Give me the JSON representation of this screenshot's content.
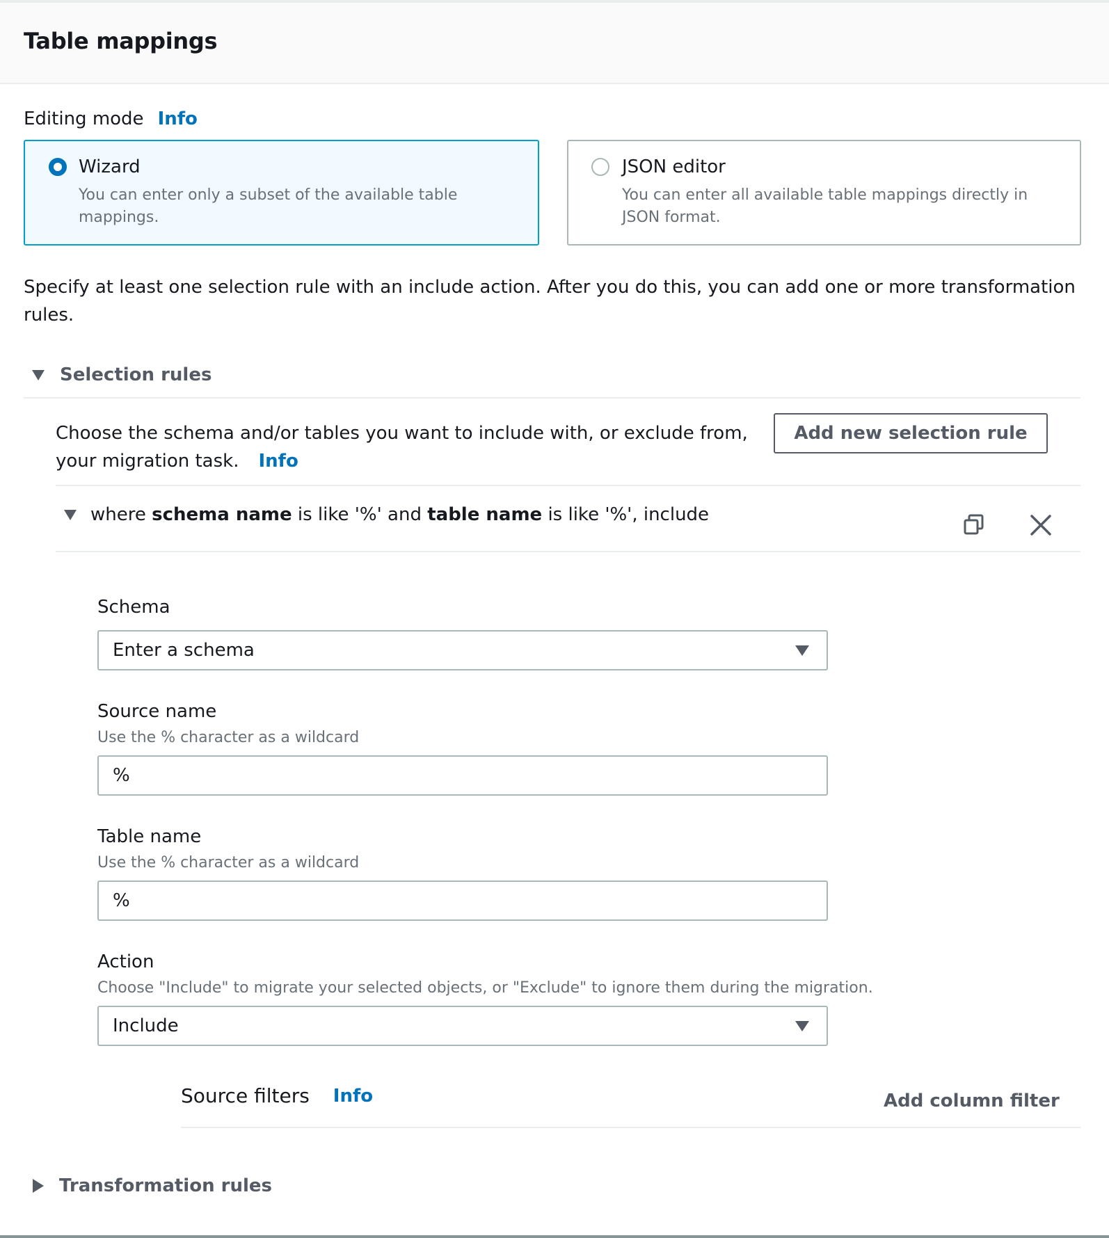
{
  "header": {
    "title": "Table mappings"
  },
  "editing_mode": {
    "label": "Editing mode",
    "info_label": "Info",
    "options": [
      {
        "id": "wizard",
        "title": "Wizard",
        "description": "You can enter only a subset of the available table mappings.",
        "selected": true
      },
      {
        "id": "json",
        "title": "JSON editor",
        "description": "You can enter all available table mappings directly in JSON format.",
        "selected": false
      }
    ]
  },
  "intro_text": "Specify at least one selection rule with an include action. After you do this, you can add one or more transformation rules.",
  "selection_rules": {
    "heading": "Selection rules",
    "expanded": true,
    "description": "Choose the schema and/or tables you want to include with, or exclude from, your migration task.",
    "info_label": "Info",
    "add_button_label": "Add new selection rule",
    "rule": {
      "summary_parts": [
        "where ",
        "schema name",
        " is like '%' and ",
        "table name",
        " is like '%', include"
      ],
      "expanded": true,
      "copy_icon": "copy-icon",
      "remove_icon": "close-icon",
      "schema": {
        "label": "Schema",
        "value": "Enter a schema"
      },
      "source_name": {
        "label": "Source name",
        "hint": "Use the % character as a wildcard",
        "value": "%"
      },
      "table_name": {
        "label": "Table name",
        "hint": "Use the % character as a wildcard",
        "value": "%"
      },
      "action": {
        "label": "Action",
        "hint": "Choose \"Include\" to migrate your selected objects, or \"Exclude\" to ignore them during the migration.",
        "value": "Include"
      },
      "source_filters": {
        "label": "Source filters",
        "info_label": "Info",
        "add_filter_label": "Add column filter"
      }
    }
  },
  "transformation_rules": {
    "heading": "Transformation rules",
    "expanded": false
  },
  "colors": {
    "accent": "#0073bb",
    "selected_tile_border": "#00a1c9",
    "selected_tile_bg": "#f1faff",
    "text_primary": "#16191f",
    "text_secondary": "#687078",
    "control_gray": "#545b64"
  }
}
